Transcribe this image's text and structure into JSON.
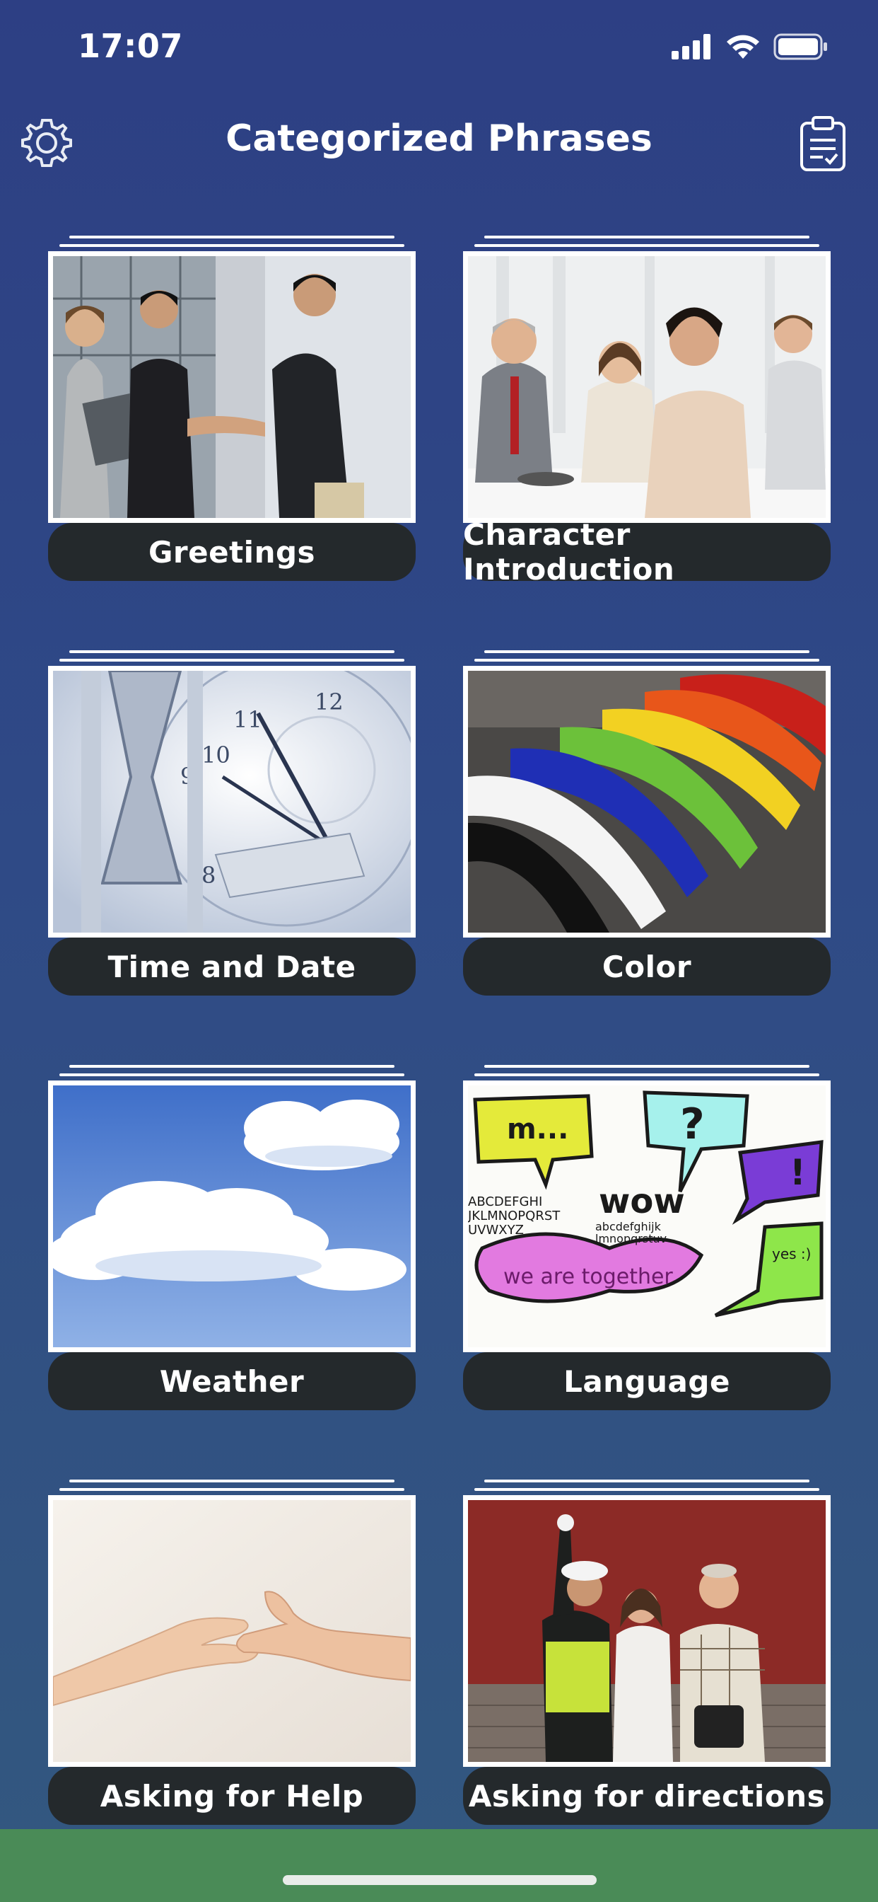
{
  "status_bar": {
    "time": "17:07"
  },
  "nav": {
    "title": "Categorized Phrases"
  },
  "categories": [
    {
      "label": "Greetings"
    },
    {
      "label": "Character Introduction"
    },
    {
      "label": "Time and Date"
    },
    {
      "label": "Color"
    },
    {
      "label": "Weather"
    },
    {
      "label": "Language"
    },
    {
      "label": "Asking for Help"
    },
    {
      "label": "Asking for directions"
    }
  ],
  "colors": {
    "background": "#2d3f84",
    "label_bg": "#24292c",
    "bottom_bar": "#4a8b57"
  }
}
